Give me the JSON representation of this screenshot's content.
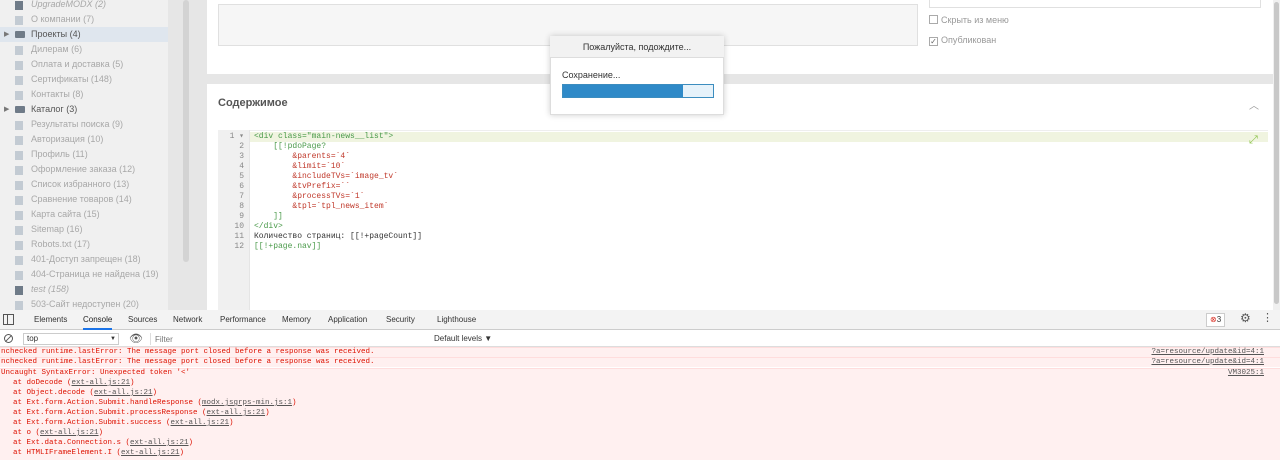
{
  "tree": {
    "items": [
      {
        "label": "UpgradeMODX (2)",
        "style": "unpub",
        "arrow": ""
      },
      {
        "label": "О компании (7)",
        "style": "dim",
        "arrow": ""
      },
      {
        "label": "Проекты (4)",
        "style": "folder",
        "arrow": "▶"
      },
      {
        "label": "Дилерам (6)",
        "style": "dim",
        "arrow": ""
      },
      {
        "label": "Оплата и доставка (5)",
        "style": "dim",
        "arrow": ""
      },
      {
        "label": "Сертификаты (148)",
        "style": "dim",
        "arrow": ""
      },
      {
        "label": "Контакты (8)",
        "style": "dim",
        "arrow": ""
      },
      {
        "label": "Каталог (3)",
        "style": "folder",
        "arrow": "▶"
      },
      {
        "label": "Результаты поиска (9)",
        "style": "dim",
        "arrow": ""
      },
      {
        "label": "Авторизация (10)",
        "style": "dim",
        "arrow": ""
      },
      {
        "label": "Профиль (11)",
        "style": "dim",
        "arrow": ""
      },
      {
        "label": "Оформление заказа (12)",
        "style": "dim",
        "arrow": ""
      },
      {
        "label": "Список избранного (13)",
        "style": "dim",
        "arrow": ""
      },
      {
        "label": "Сравнение товаров (14)",
        "style": "dim",
        "arrow": ""
      },
      {
        "label": "Карта сайта (15)",
        "style": "dim",
        "arrow": ""
      },
      {
        "label": "Sitemap (16)",
        "style": "dim",
        "arrow": ""
      },
      {
        "label": "Robots.txt (17)",
        "style": "dim",
        "arrow": ""
      },
      {
        "label": "401-Доступ запрещен (18)",
        "style": "dim",
        "arrow": ""
      },
      {
        "label": "404-Страница не найдена (19)",
        "style": "dim",
        "arrow": ""
      },
      {
        "label": "test (158)",
        "style": "unpub",
        "arrow": ""
      },
      {
        "label": "503-Сайт недоступен (20)",
        "style": "dim",
        "arrow": ""
      }
    ]
  },
  "settings": {
    "hide_menu": "Скрыть из меню",
    "published": "Опубликован",
    "published_check": "✓"
  },
  "content": {
    "title": "Содержимое",
    "collapse_icon": "︿",
    "expand_icon": "⤢",
    "lines": [
      {
        "n": "1 ▾",
        "text": "<div class=\"main-news__list\">"
      },
      {
        "n": "2",
        "text": "    [[!pdoPage?"
      },
      {
        "n": "3",
        "text": "        &parents=`4`"
      },
      {
        "n": "4",
        "text": "        &limit=`10`"
      },
      {
        "n": "5",
        "text": "        &includeTVs=`image_tv`"
      },
      {
        "n": "6",
        "text": "        &tvPrefix=``"
      },
      {
        "n": "7",
        "text": "        &processTVs=`1`"
      },
      {
        "n": "8",
        "text": "        &tpl=`tpl_news_item`"
      },
      {
        "n": "9",
        "text": "    ]]"
      },
      {
        "n": "10",
        "text": "</div>"
      },
      {
        "n": "11",
        "text": "Количество страниц: [[!+pageCount]]"
      },
      {
        "n": "12",
        "text": "[[!+page.nav]]"
      }
    ]
  },
  "wait_dialog": {
    "title": "Пожалуйста, подождите...",
    "text": "Сохранение...",
    "progress": 0.8
  },
  "devtools": {
    "tabs": [
      "Elements",
      "Console",
      "Sources",
      "Network",
      "Performance",
      "Memory",
      "Application",
      "Security",
      "Lighthouse"
    ],
    "active_tab": "Console",
    "error_count": "3",
    "context": "top",
    "filter_placeholder": "Filter",
    "levels": "Default levels ▼",
    "messages": [
      {
        "text": "nchecked runtime.lastError: The message port closed before a response was received.",
        "source": "?a=resource/update&id=4:1"
      },
      {
        "text": "nchecked runtime.lastError: The message port closed before a response was received.",
        "source": "?a=resource/update&id=4:1"
      },
      {
        "text": "Uncaught SyntaxError: Unexpected token '<'",
        "source": "VM3025:1"
      }
    ],
    "stack": [
      {
        "pre": "at doDecode (",
        "file": "ext-all.js:21",
        "post": ")"
      },
      {
        "pre": "at Object.decode (",
        "file": "ext-all.js:21",
        "post": ")"
      },
      {
        "pre": "at Ext.form.Action.Submit.handleResponse (",
        "file": "modx.jsgrps-min.js:1",
        "post": ")"
      },
      {
        "pre": "at Ext.form.Action.Submit.processResponse (",
        "file": "ext-all.js:21",
        "post": ")"
      },
      {
        "pre": "at Ext.form.Action.Submit.success (",
        "file": "ext-all.js:21",
        "post": ")"
      },
      {
        "pre": "at o (",
        "file": "ext-all.js:21",
        "post": ")"
      },
      {
        "pre": "at Ext.data.Connection.s (",
        "file": "ext-all.js:21",
        "post": ")"
      },
      {
        "pre": "at HTMLIFrameElement.I (",
        "file": "ext-all.js:21",
        "post": ")"
      }
    ]
  }
}
